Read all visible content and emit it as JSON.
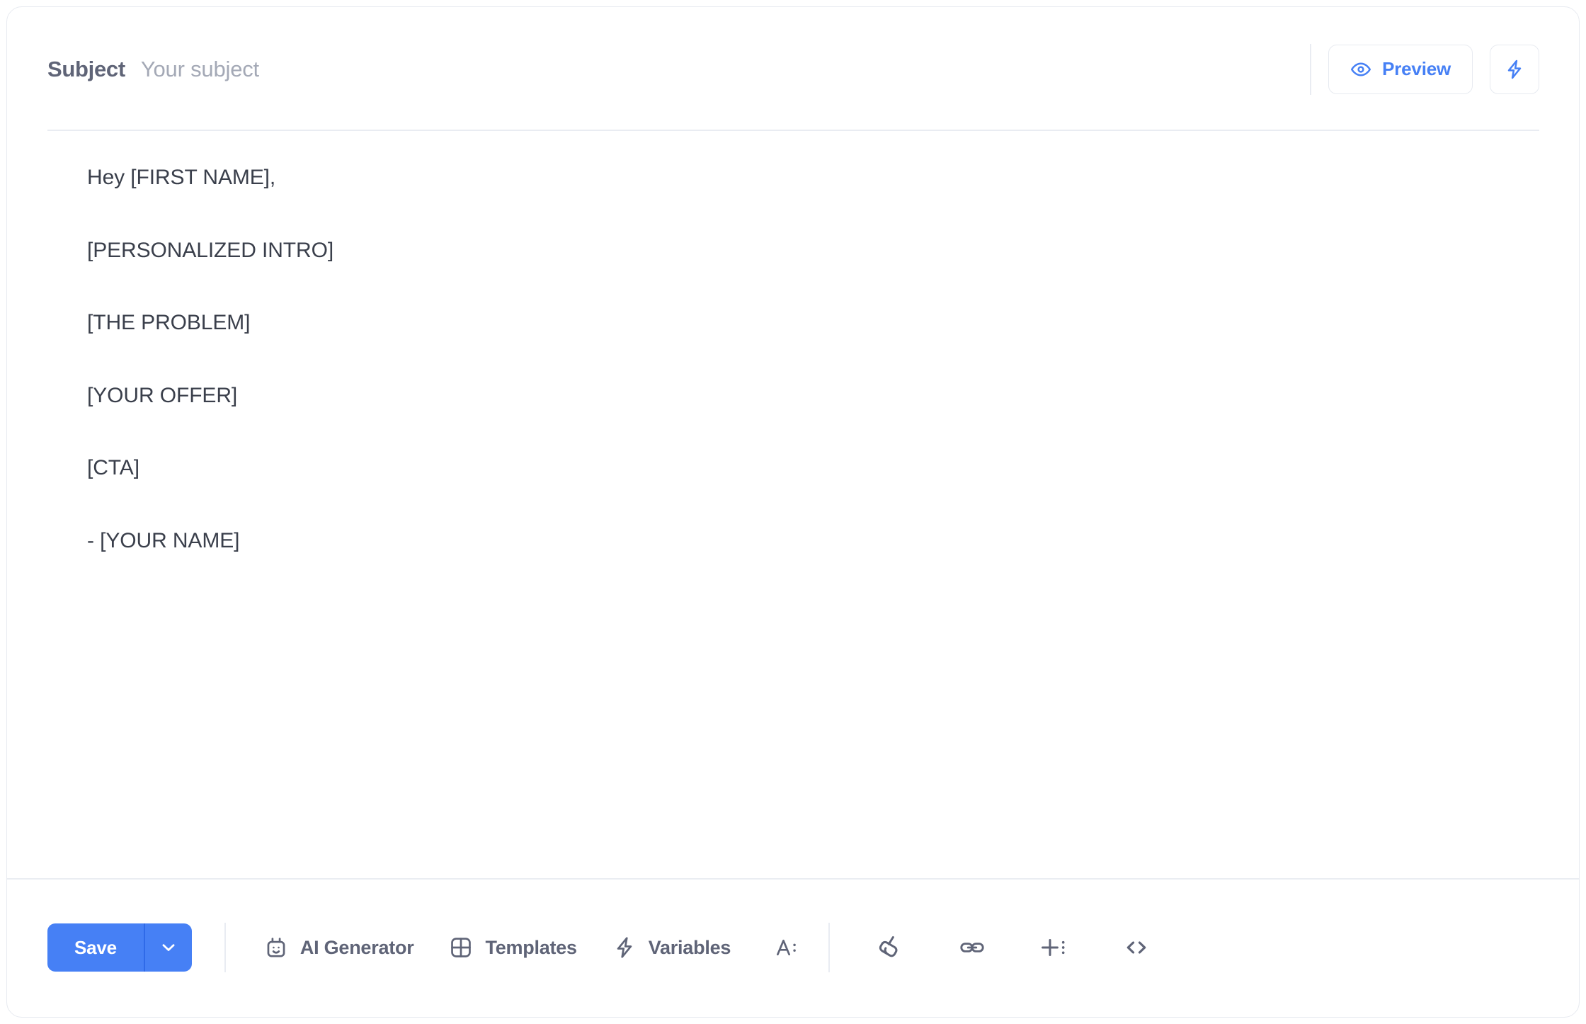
{
  "card": {
    "accent_color": "#4680f5",
    "border_color": "#e7eaf0",
    "text_color": "#3a3f4b",
    "muted_color": "#5f6477",
    "placeholder_color": "#a4a9b6"
  },
  "subject": {
    "label": "Subject",
    "value": "",
    "placeholder": "Your subject"
  },
  "header_actions": {
    "preview_label": "Preview",
    "preview_icon": "eye-icon",
    "quick_action_icon": "lightning-bolt-icon"
  },
  "body": {
    "lines": [
      "Hey [FIRST NAME],",
      "[PERSONALIZED INTRO]",
      "[THE PROBLEM]",
      "[YOUR OFFER]",
      "[CTA]",
      "- [YOUR NAME]"
    ]
  },
  "toolbar": {
    "save_label": "Save",
    "save_caret_icon": "chevron-down-icon",
    "items": [
      {
        "label": "AI Generator",
        "icon": "robot-icon"
      },
      {
        "label": "Templates",
        "icon": "layout-grid-icon"
      },
      {
        "label": "Variables",
        "icon": "lightning-bolt-icon"
      }
    ],
    "icon_buttons": [
      {
        "name": "text-format",
        "icon": "text-format-icon"
      },
      {
        "name": "clear-formatting",
        "icon": "broom-icon"
      },
      {
        "name": "insert-link",
        "icon": "link-icon"
      },
      {
        "name": "insert-element",
        "icon": "plus-list-icon"
      },
      {
        "name": "source-code",
        "icon": "code-icon"
      }
    ]
  }
}
